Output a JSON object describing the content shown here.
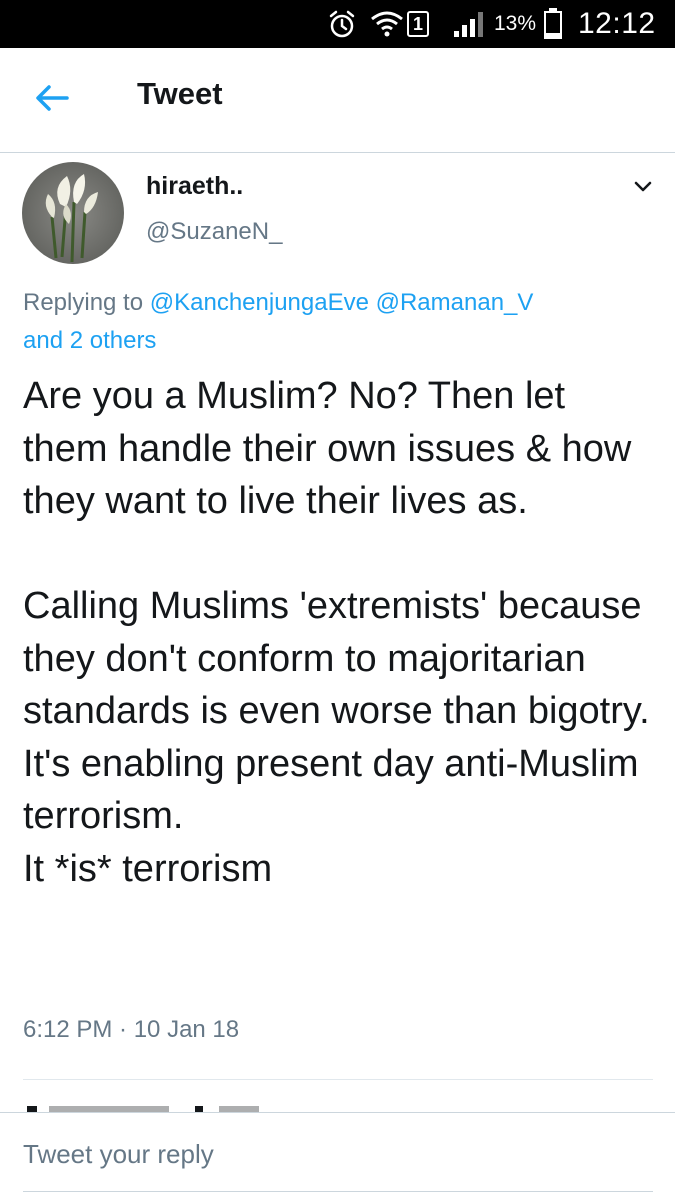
{
  "status_bar": {
    "battery_percent": "13%",
    "sim_slot": "1",
    "time": "12:12",
    "icons": [
      "alarm-icon",
      "wifi-icon",
      "sim-icon",
      "signal-icon",
      "battery-icon"
    ]
  },
  "header": {
    "title": "Tweet",
    "back_icon": "arrow-left-icon"
  },
  "tweet": {
    "author": {
      "display_name": "hiraeth..",
      "handle": "@SuzaneN_",
      "avatar_icon": "calla-lily-avatar"
    },
    "replying_prefix": "Replying to ",
    "replying_to": [
      "@KanchenjungaEve",
      "@Ramanan_V"
    ],
    "replying_others": "and 2 others",
    "text": "Are you a Muslim? No? Then let them handle their own issues & how they want to live their lives as.\n\nCalling Muslims 'extremists' because they don't conform to majoritarian standards is even worse than bigotry.\nIt's enabling present day anti-Muslim terrorism.\nIt *is* terrorism",
    "timestamp": "6:12 PM · 10 Jan 18"
  },
  "reply": {
    "placeholder": "Tweet your reply"
  },
  "colors": {
    "accent": "#1da1f2",
    "secondary_text": "#657786",
    "primary_text": "#14171a",
    "divider": "#ccd6dd"
  }
}
